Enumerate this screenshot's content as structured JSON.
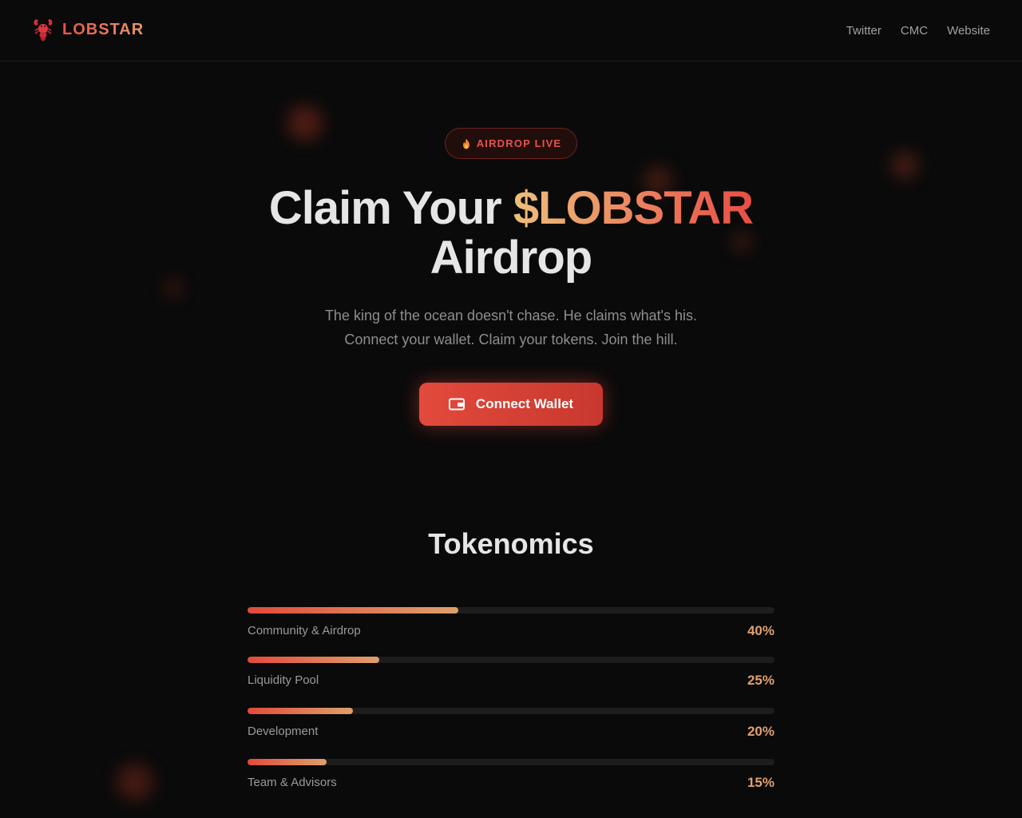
{
  "header": {
    "brand": "LOBSTAR",
    "nav": [
      "Twitter",
      "CMC",
      "Website"
    ]
  },
  "hero": {
    "badge": "AIRDROP LIVE",
    "title_prefix": "Claim Your ",
    "title_accent": "$LOBSTAR",
    "title_suffix": "Airdrop",
    "subtitle_line1": "The king of the ocean doesn't chase. He claims what's his.",
    "subtitle_line2": "Connect your wallet. Claim your tokens. Join the hill.",
    "cta_label": "Connect Wallet"
  },
  "tokenomics": {
    "title": "Tokenomics",
    "items": [
      {
        "label": "Community & Airdrop",
        "percent_text": "40%",
        "share": 0.4
      },
      {
        "label": "Liquidity Pool",
        "percent_text": "25%",
        "share": 0.25
      },
      {
        "label": "Development",
        "percent_text": "20%",
        "share": 0.2
      },
      {
        "label": "Team & Advisors",
        "percent_text": "15%",
        "share": 0.15
      }
    ]
  },
  "colors": {
    "background": "#0a0a0a",
    "accent_red": "#e24a3c",
    "accent_gold": "#e0a06c"
  },
  "icons": {
    "brand": "lobster-icon",
    "badge": "fire-icon",
    "cta": "wallet-icon"
  }
}
